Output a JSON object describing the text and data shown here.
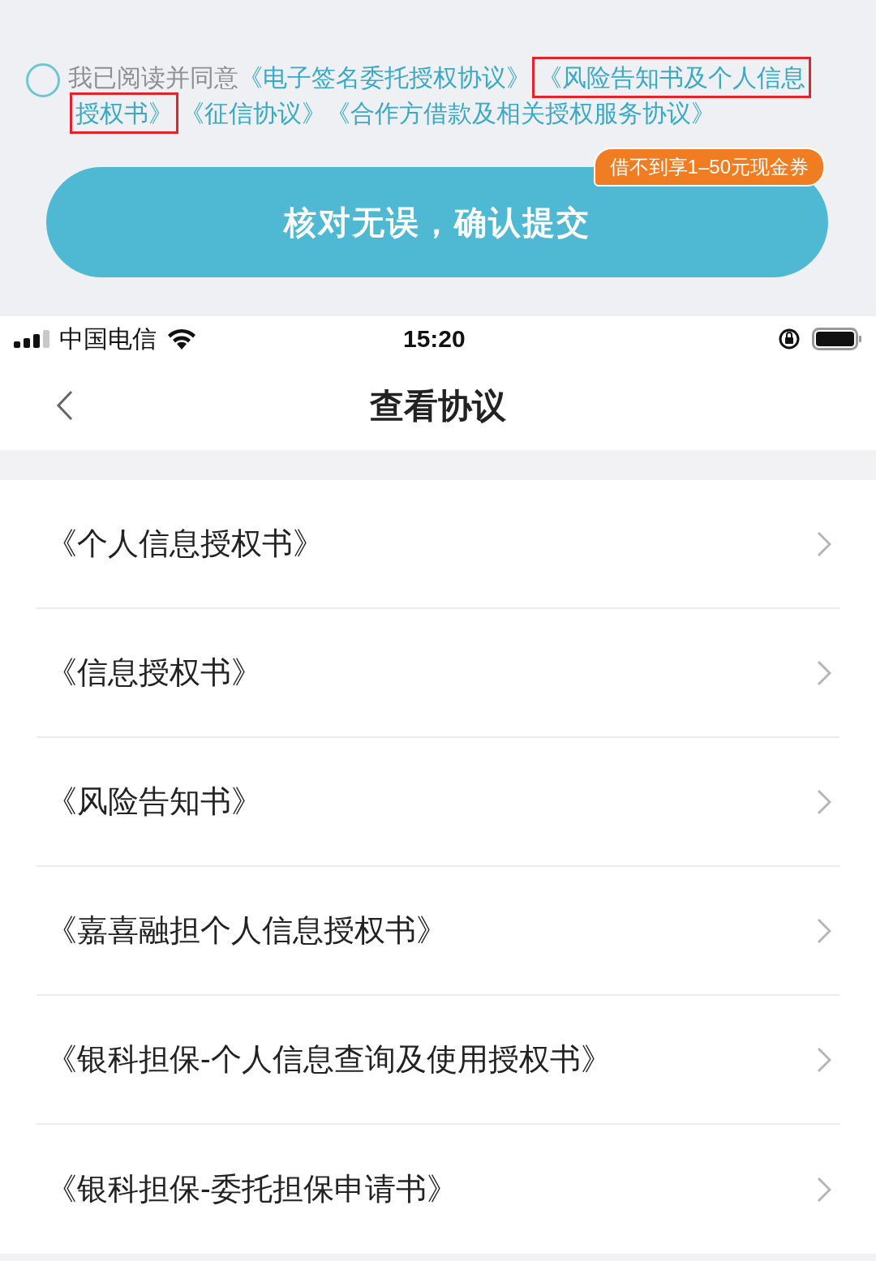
{
  "agreement": {
    "checked": false,
    "lead": "我已阅读并同意",
    "links": [
      {
        "text": "《电子签名委托授权协议》",
        "highlighted": false
      },
      {
        "text": "《风险告知书及个人信息",
        "highlighted": true
      },
      {
        "text": "授权书》",
        "highlighted": true
      },
      {
        "text": "《征信协议》",
        "highlighted": false
      },
      {
        "text": "《合作方借款及相关授权服务协议》",
        "highlighted": false
      }
    ]
  },
  "submit": {
    "label": "核对无误，确认提交",
    "badge": "借不到享1–50元现金券"
  },
  "status_bar": {
    "carrier": "中国电信",
    "time": "15:20"
  },
  "nav": {
    "title": "查看协议"
  },
  "agreements": [
    {
      "title": "《个人信息授权书》"
    },
    {
      "title": "《信息授权书》"
    },
    {
      "title": "《风险告知书》"
    },
    {
      "title": "《嘉喜融担个人信息授权书》"
    },
    {
      "title": "《银科担保-个人信息查询及使用授权书》"
    },
    {
      "title": "《银科担保-委托担保申请书》"
    }
  ]
}
